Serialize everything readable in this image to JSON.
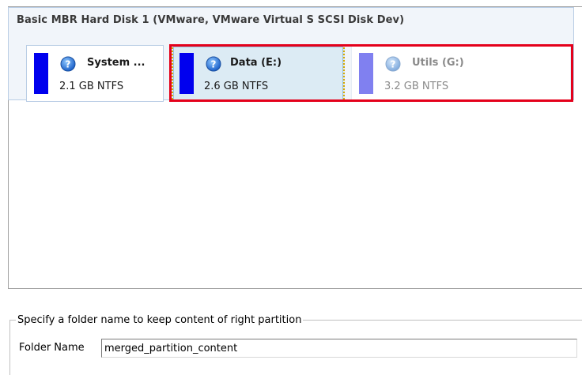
{
  "disk": {
    "title": "Basic MBR Hard Disk 1 (VMware, VMware Virtual S SCSI Disk Dev)"
  },
  "partitions": [
    {
      "name": "System ...",
      "size": "2.1 GB NTFS",
      "bar_color": "#0000ee",
      "state": "normal"
    },
    {
      "name": "Data (E:)",
      "size": "2.6 GB NTFS",
      "bar_color": "#0000ee",
      "state": "selected"
    },
    {
      "name": "Utils (G:)",
      "size": "3.2 GB NTFS",
      "bar_color": "#8080f0",
      "state": "dimmed"
    }
  ],
  "icons": {
    "partition_icon": "help-question-icon"
  },
  "colors": {
    "highlight_frame": "#e4001b",
    "selected_border": "#d6a800"
  },
  "folder_group": {
    "legend": "Specify a folder name to keep content of right partition",
    "label": "Folder Name",
    "value": "merged_partition_content"
  }
}
